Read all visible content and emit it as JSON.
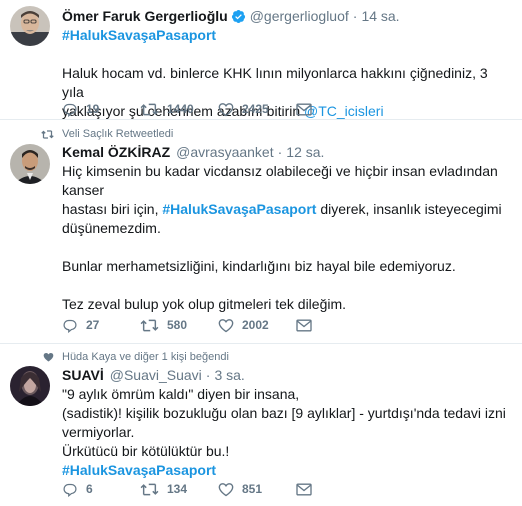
{
  "tweets": [
    {
      "context": "",
      "fullname": "Ömer Faruk Gergerlioğlu",
      "username": "@gergerliogluof",
      "time": "14 sa.",
      "hashtag_line": "#HalukSavaşaPasaport",
      "body_line1": "Haluk hocam vd. binlerce KHK lının milyonlarca hakkını çiğnediniz, 3 yıla",
      "body_line2_text": "yaklaşıyor şu cehennem azabını bitirin ",
      "body_line2_mention": "@TC_icisleri",
      "replies": "19",
      "retweets": "1440",
      "likes": "2425"
    },
    {
      "context": "Veli Saçlık Retweetledi",
      "fullname": "Kemal ÖZKİRAZ",
      "username": "@avrasyaanket",
      "time": "12 sa.",
      "line1": "Hiç kimsenin bu kadar vicdansız olabileceği ve hiçbir insan evladından kanser",
      "line2_pre": "hastası biri için, ",
      "line2_hashtag": "#HalukSavaşaPasaport",
      "line2_post": " diyerek, insanlık isteyecegimi",
      "line3": "düşünemezdim.",
      "line4": "Bunlar merhametsizliğini, kindarlığını biz hayal bile edemiyoruz.",
      "line5": "Tez zeval bulup yok olup gitmeleri tek dileğim.",
      "replies": "27",
      "retweets": "580",
      "likes": "2002"
    },
    {
      "context": "Hüda Kaya ve diğer 1 kişi beğendi",
      "fullname": "SUAVİ",
      "username": "@Suavi_Suavi",
      "time": "3 sa.",
      "line1": "\"9 aylık ömrüm kaldı\" diyen bir insana,",
      "line2": "(sadistik)! kişilik bozukluğu olan bazı [9 aylıklar] - yurtdışı'nda tedavi izni",
      "line3": "vermiyorlar.",
      "line4": "Ürkütücü bir kötülüktür bu.!",
      "hashtag_line": "#HalukSavaşaPasaport",
      "replies": "6",
      "retweets": "134",
      "likes": "851"
    }
  ],
  "icons": {
    "reply": "reply-icon",
    "retweet": "retweet-icon",
    "like": "heart-icon",
    "dm": "envelope-icon",
    "verified": "verified-badge-icon"
  },
  "colors": {
    "link": "#1b95e0",
    "muted": "#657786",
    "verified": "#1da1f2",
    "border": "#e6ecf0"
  }
}
